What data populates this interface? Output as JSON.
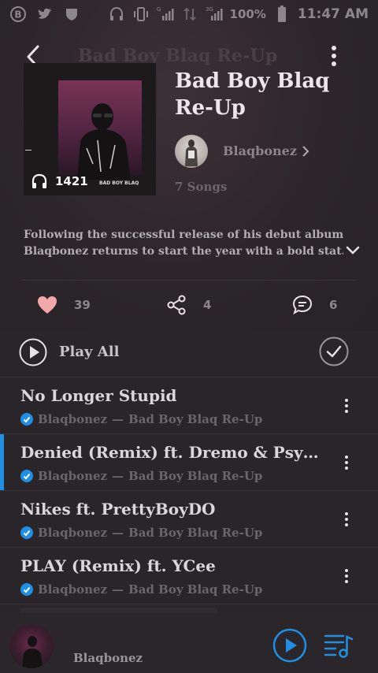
{
  "status_bar": {
    "battery": "100%",
    "time": "11:47 AM",
    "icons": [
      "b-circle-icon",
      "twitter-icon",
      "shield-icon",
      "headphones-icon",
      "vibrate-icon",
      "signal-icon",
      "data-arrows-icon",
      "signal-icon",
      "battery-icon"
    ],
    "network_labels": [
      "G",
      "3G"
    ]
  },
  "header": {
    "title": "Bad Boy Blaq Re-Up"
  },
  "album": {
    "title": "Bad Boy Blaq Re-Up",
    "play_count": "1421",
    "cover_label": "BAD BOY BLAQ",
    "artist": "Blaqbonez",
    "song_count": "7 Songs",
    "description_line1": "Following the successful release of his debut album,",
    "description_line2": "Blaqbonez returns to start the year with a bold stat..."
  },
  "actions": {
    "likes": "39",
    "shares": "4",
    "comments": "6"
  },
  "play_all": {
    "label": "Play All"
  },
  "tracks": [
    {
      "title": "No Longer Stupid",
      "artist": "Blaqbonez",
      "separator": "—",
      "album": "Bad Boy Blaq Re-Up",
      "active": false
    },
    {
      "title": "Denied (Remix) ft. Dremo & Psych...",
      "artist": "Blaqbonez",
      "separator": "—",
      "album": "Bad Boy Blaq Re-Up",
      "active": true
    },
    {
      "title": "Nikes ft. PrettyBoyDO",
      "artist": "Blaqbonez",
      "separator": "—",
      "album": "Bad Boy Blaq Re-Up",
      "active": false
    },
    {
      "title": "PLAY (Remix) ft. YCee",
      "artist": "Blaqbonez",
      "separator": "—",
      "album": "Bad Boy Blaq Re-Up",
      "active": false
    }
  ],
  "mini_player": {
    "artist": "Blaqbonez"
  },
  "colors": {
    "background": "#2a2528",
    "accent": "#1f8fe6",
    "heart": "#f2a7a8"
  }
}
